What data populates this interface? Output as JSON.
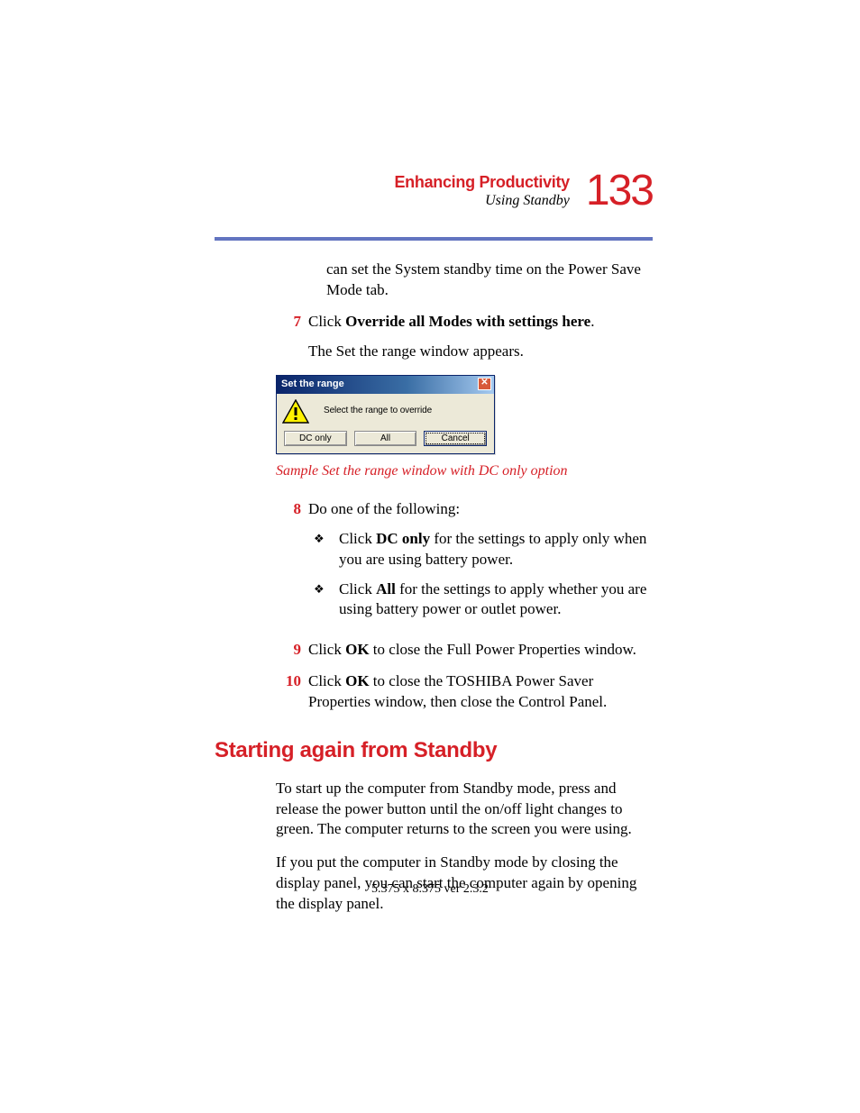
{
  "header": {
    "chapter": "Enhancing Productivity",
    "section": "Using Standby",
    "page_number": "133"
  },
  "carry_over_paragraph": "can set the System standby time on the Power Save Mode tab.",
  "steps": {
    "s7_pre": "Click ",
    "s7_bold": "Override all Modes with settings here",
    "s7_post": ".",
    "s7_follow": "The Set the range window appears.",
    "s8_intro": "Do one of the following:",
    "s8_b1_pre": "Click ",
    "s8_b1_bold": "DC only",
    "s8_b1_post": " for the settings to apply only when you are using battery power.",
    "s8_b2_pre": "Click ",
    "s8_b2_bold": "All",
    "s8_b2_post": " for the settings to apply whether you are using battery power or outlet power.",
    "s9_pre": "Click ",
    "s9_bold": "OK",
    "s9_post": " to close the Full Power Properties window.",
    "s10_pre": "Click ",
    "s10_bold": "OK",
    "s10_post": " to close the TOSHIBA Power Saver Properties window, then close the Control Panel."
  },
  "numbers": {
    "n7": "7",
    "n8": "8",
    "n9": "9",
    "n10": "10"
  },
  "dialog": {
    "title": "Set the range",
    "message": "Select the range to override",
    "btn_dc_only": "DC only",
    "btn_all": "All",
    "btn_cancel": "Cancel",
    "close_glyph": "✕"
  },
  "caption": "Sample Set the range window with DC only option",
  "section2": {
    "heading": "Starting again from Standby",
    "p1": "To start up the computer from Standby mode, press and release the power button until the on/off light changes to green. The computer returns to the screen you were using.",
    "p2": "If you put the computer in Standby mode by closing the display panel, you can start the computer again by opening the display panel."
  },
  "footer": "5.375 x 8.375 ver 2.3.2",
  "colors": {
    "accent_red": "#d62027",
    "divider_blue": "#6274c0",
    "win_titlebar_start": "#0a246a",
    "win_face": "#ece9d8"
  }
}
